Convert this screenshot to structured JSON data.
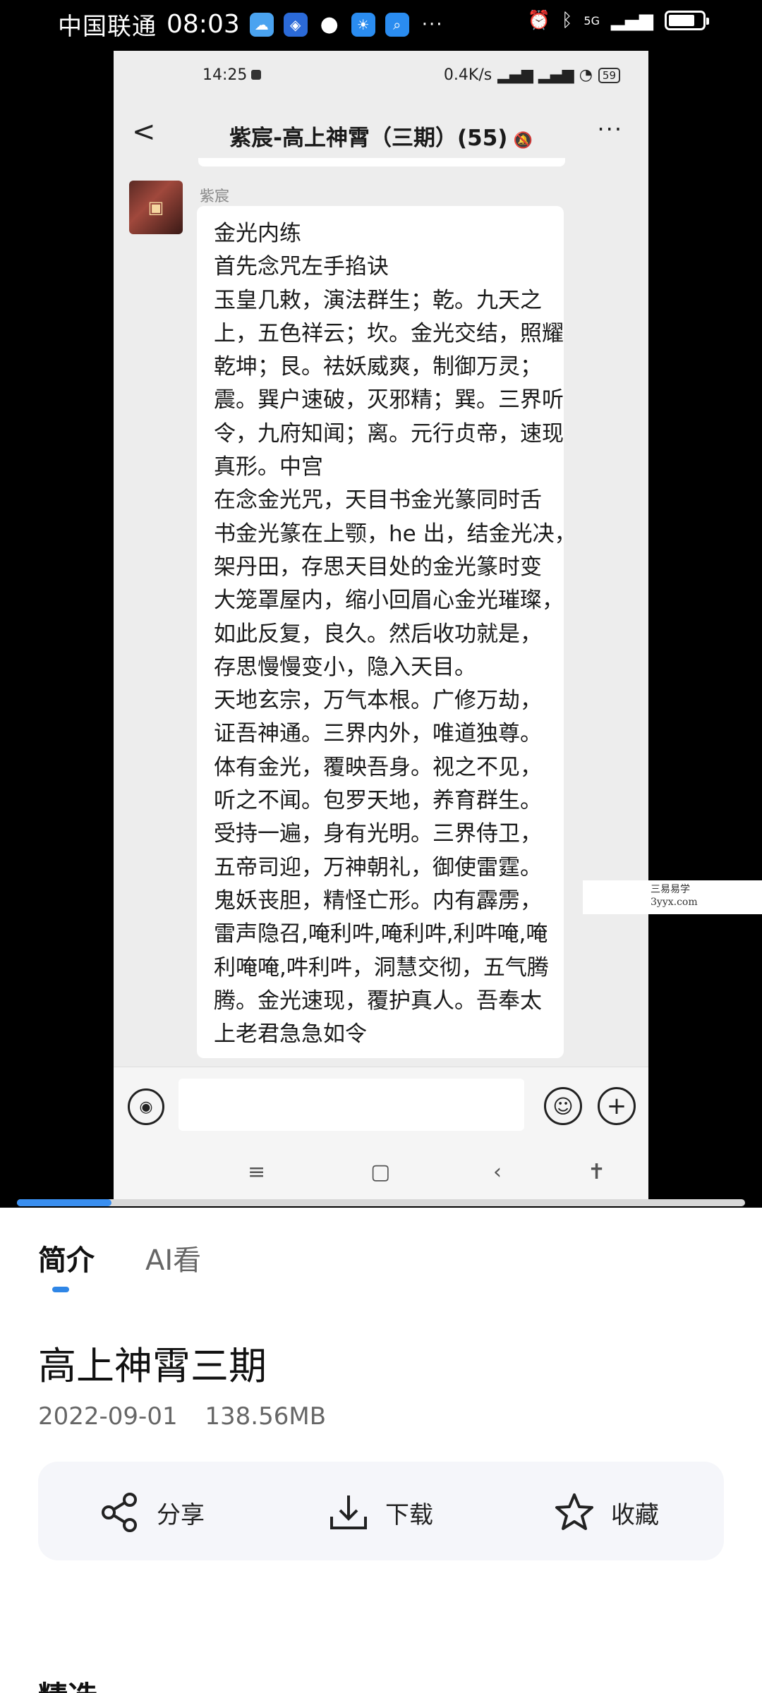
{
  "status_bar": {
    "carrier": "中国联通",
    "time": "08:03",
    "dots": "···",
    "network": "5G"
  },
  "video": {
    "phone_status": {
      "time": "14:25",
      "speed": "0.4K/s",
      "battery": "59"
    },
    "chat": {
      "title": "紫宸-高上神霄（三期）(55)",
      "sender": "紫宸",
      "message_lines": [
        "金光内练",
        "首先念咒左手掐诀",
        "玉皇几敕，演法群生；乾。九天之",
        "上，五色祥云；坎。金光交结，照耀",
        "乾坤；艮。祛妖威爽，制御万灵；",
        "震。巽户速破，灭邪精；巽。三界听",
        "令，九府知闻；离。元行贞帝，速现",
        "真形。中宫",
        "在念金光咒，天目书金光篆同时舌",
        "书金光篆在上颚，he 出，结金光决，",
        "架丹田，存思天目处的金光篆时变",
        "大笼罩屋内，缩小回眉心金光璀璨，",
        "如此反复，良久。然后收功就是，",
        "存思慢慢变小，隐入天目。",
        "天地玄宗，万气本根。广修万劫，",
        "证吾神通。三界内外，唯道独尊。",
        "体有金光，覆映吾身。视之不见，",
        "听之不闻。包罗天地，养育群生。",
        "受持一遍，身有光明。三界侍卫，",
        "五帝司迎，万神朝礼，御使雷霆。",
        "鬼妖丧胆，精怪亡形。内有霹雳，",
        "雷声隐召,唵利吽,唵利吽,利吽唵,唵",
        "利唵唵,吽利吽，洞慧交彻，五气腾",
        "腾。金光速现，覆护真人。吾奉太",
        "上老君急急如令"
      ]
    },
    "watermark": {
      "line1": "三易易学",
      "line2": "3yyx.com"
    },
    "progress": 0.13
  },
  "sheet": {
    "tabs": [
      {
        "label": "简介"
      },
      {
        "label": "AI看"
      }
    ],
    "title": "高上神霄三期",
    "date": "2022-09-01",
    "size": "138.56MB",
    "actions": {
      "share": "分享",
      "download": "下载",
      "favorite": "收藏"
    },
    "section_title": "精选"
  }
}
